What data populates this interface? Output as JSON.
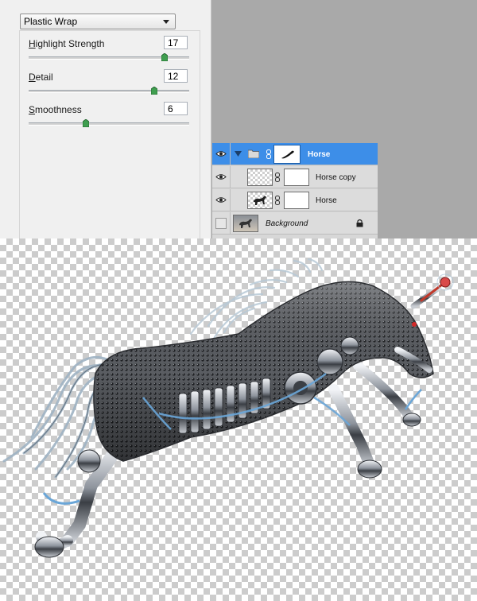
{
  "filter": {
    "selected": "Plastic Wrap",
    "params": [
      {
        "label": "Highlight Strength",
        "accel": "H",
        "rest": "ighlight Strength",
        "value": "17",
        "fraction": 0.85
      },
      {
        "label": "Detail",
        "accel": "D",
        "rest": "etail",
        "value": "12",
        "fraction": 0.8
      },
      {
        "label": "Smoothness",
        "accel": "S",
        "rest": "moothness",
        "value": "6",
        "fraction": 0.36
      }
    ]
  },
  "layers": [
    {
      "name": "Horse",
      "type": "group",
      "visible": true,
      "selected": true
    },
    {
      "name": "Horse copy",
      "type": "layer",
      "visible": true,
      "selected": false
    },
    {
      "name": "Horse",
      "type": "layer",
      "visible": true,
      "selected": false
    },
    {
      "name": "Background",
      "type": "background",
      "visible": false,
      "locked": true
    }
  ],
  "colors": {
    "selection": "#3d8ee8",
    "slider_handle": "#3f9e4f",
    "gray_bg": "#a9a9a9"
  },
  "icons": [
    "dropdown-arrow-icon",
    "eye-icon",
    "folder-icon",
    "chain-link-icon",
    "lock-icon",
    "disclosure-triangle-icon"
  ]
}
